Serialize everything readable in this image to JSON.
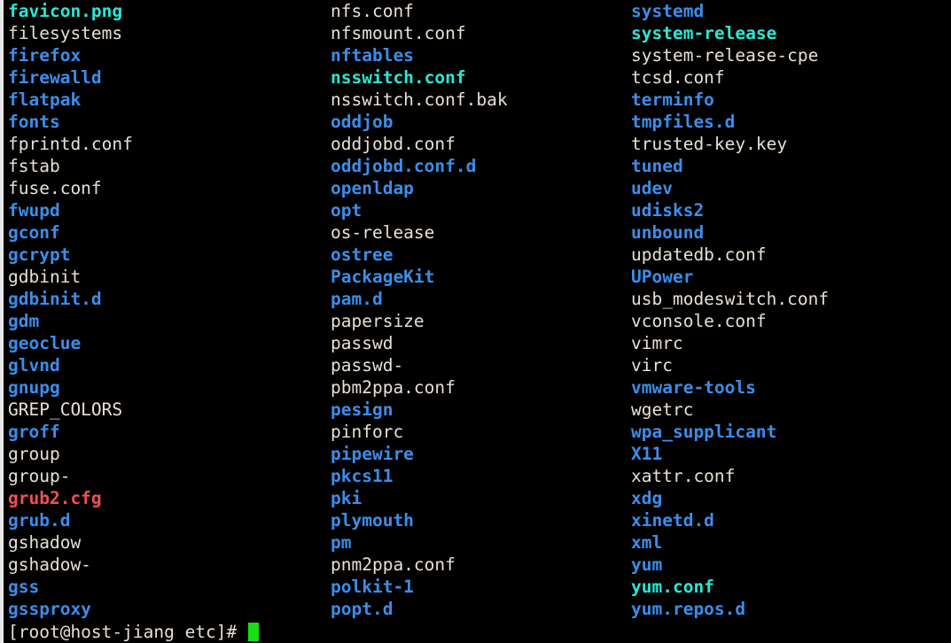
{
  "terminal": {
    "background_color": "#000000",
    "foreground_color": "#e8e0d4",
    "directory_color": "#3b8eea",
    "symlink_color": "#29e8d5",
    "archive_color": "#f25050",
    "cursor_color": "#15e015"
  },
  "prompt": {
    "text": "[root@host-jiang etc]# ",
    "user": "root",
    "host": "host-jiang",
    "cwd": "etc",
    "sigil": "#"
  },
  "columns": [
    {
      "name": "column-1",
      "entries": [
        {
          "label": "favicon.png",
          "type": "link"
        },
        {
          "label": "filesystems",
          "type": "file"
        },
        {
          "label": "firefox",
          "type": "dir"
        },
        {
          "label": "firewalld",
          "type": "dir"
        },
        {
          "label": "flatpak",
          "type": "dir"
        },
        {
          "label": "fonts",
          "type": "dir"
        },
        {
          "label": "fprintd.conf",
          "type": "file"
        },
        {
          "label": "fstab",
          "type": "file"
        },
        {
          "label": "fuse.conf",
          "type": "file"
        },
        {
          "label": "fwupd",
          "type": "dir"
        },
        {
          "label": "gconf",
          "type": "dir"
        },
        {
          "label": "gcrypt",
          "type": "dir"
        },
        {
          "label": "gdbinit",
          "type": "file"
        },
        {
          "label": "gdbinit.d",
          "type": "dir"
        },
        {
          "label": "gdm",
          "type": "dir"
        },
        {
          "label": "geoclue",
          "type": "dir"
        },
        {
          "label": "glvnd",
          "type": "dir"
        },
        {
          "label": "gnupg",
          "type": "dir"
        },
        {
          "label": "GREP_COLORS",
          "type": "file"
        },
        {
          "label": "groff",
          "type": "dir"
        },
        {
          "label": "group",
          "type": "file"
        },
        {
          "label": "group-",
          "type": "file"
        },
        {
          "label": "grub2.cfg",
          "type": "archive"
        },
        {
          "label": "grub.d",
          "type": "dir"
        },
        {
          "label": "gshadow",
          "type": "file"
        },
        {
          "label": "gshadow-",
          "type": "file"
        },
        {
          "label": "gss",
          "type": "dir"
        },
        {
          "label": "gssproxy",
          "type": "dir"
        }
      ]
    },
    {
      "name": "column-2",
      "entries": [
        {
          "label": "nfs.conf",
          "type": "file"
        },
        {
          "label": "nfsmount.conf",
          "type": "file"
        },
        {
          "label": "nftables",
          "type": "dir"
        },
        {
          "label": "nsswitch.conf",
          "type": "link"
        },
        {
          "label": "nsswitch.conf.bak",
          "type": "file"
        },
        {
          "label": "oddjob",
          "type": "dir"
        },
        {
          "label": "oddjobd.conf",
          "type": "file"
        },
        {
          "label": "oddjobd.conf.d",
          "type": "dir"
        },
        {
          "label": "openldap",
          "type": "dir"
        },
        {
          "label": "opt",
          "type": "dir"
        },
        {
          "label": "os-release",
          "type": "file"
        },
        {
          "label": "ostree",
          "type": "dir"
        },
        {
          "label": "PackageKit",
          "type": "dir"
        },
        {
          "label": "pam.d",
          "type": "dir"
        },
        {
          "label": "papersize",
          "type": "file"
        },
        {
          "label": "passwd",
          "type": "file"
        },
        {
          "label": "passwd-",
          "type": "file"
        },
        {
          "label": "pbm2ppa.conf",
          "type": "file"
        },
        {
          "label": "pesign",
          "type": "dir"
        },
        {
          "label": "pinforc",
          "type": "file"
        },
        {
          "label": "pipewire",
          "type": "dir"
        },
        {
          "label": "pkcs11",
          "type": "dir"
        },
        {
          "label": "pki",
          "type": "dir"
        },
        {
          "label": "plymouth",
          "type": "dir"
        },
        {
          "label": "pm",
          "type": "dir"
        },
        {
          "label": "pnm2ppa.conf",
          "type": "file"
        },
        {
          "label": "polkit-1",
          "type": "dir"
        },
        {
          "label": "popt.d",
          "type": "dir"
        }
      ]
    },
    {
      "name": "column-3",
      "entries": [
        {
          "label": "systemd",
          "type": "dir"
        },
        {
          "label": "system-release",
          "type": "link"
        },
        {
          "label": "system-release-cpe",
          "type": "file"
        },
        {
          "label": "tcsd.conf",
          "type": "file"
        },
        {
          "label": "terminfo",
          "type": "dir"
        },
        {
          "label": "tmpfiles.d",
          "type": "dir"
        },
        {
          "label": "trusted-key.key",
          "type": "file"
        },
        {
          "label": "tuned",
          "type": "dir"
        },
        {
          "label": "udev",
          "type": "dir"
        },
        {
          "label": "udisks2",
          "type": "dir"
        },
        {
          "label": "unbound",
          "type": "dir"
        },
        {
          "label": "updatedb.conf",
          "type": "file"
        },
        {
          "label": "UPower",
          "type": "dir"
        },
        {
          "label": "usb_modeswitch.conf",
          "type": "file"
        },
        {
          "label": "vconsole.conf",
          "type": "file"
        },
        {
          "label": "vimrc",
          "type": "file"
        },
        {
          "label": "virc",
          "type": "file"
        },
        {
          "label": "vmware-tools",
          "type": "dir"
        },
        {
          "label": "wgetrc",
          "type": "file"
        },
        {
          "label": "wpa_supplicant",
          "type": "dir"
        },
        {
          "label": "X11",
          "type": "dir"
        },
        {
          "label": "xattr.conf",
          "type": "file"
        },
        {
          "label": "xdg",
          "type": "dir"
        },
        {
          "label": "xinetd.d",
          "type": "dir"
        },
        {
          "label": "xml",
          "type": "dir"
        },
        {
          "label": "yum",
          "type": "dir"
        },
        {
          "label": "yum.conf",
          "type": "link"
        },
        {
          "label": "yum.repos.d",
          "type": "dir"
        }
      ]
    }
  ]
}
